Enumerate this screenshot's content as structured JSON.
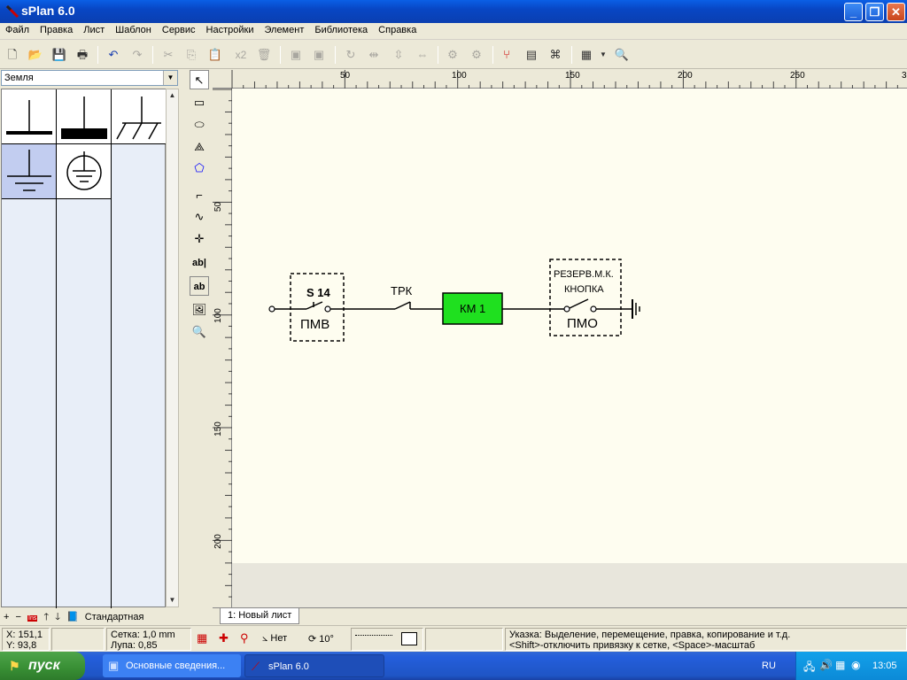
{
  "window": {
    "title": "sPlan 6.0"
  },
  "menu": [
    "Файл",
    "Правка",
    "Лист",
    "Шаблон",
    "Сервис",
    "Настройки",
    "Элемент",
    "Библиотека",
    "Справка"
  ],
  "toolbar": {
    "paste_x2": "x2"
  },
  "library": {
    "selected": "Земля",
    "footer_label": "Стандартная",
    "footer_icon": "Ins"
  },
  "tools": {
    "text_tool": "ab|",
    "text_frame_tool": "ab"
  },
  "rulers": {
    "h_labels": [
      "50",
      "100",
      "150",
      "200",
      "250",
      "3"
    ],
    "v_labels": [
      "50",
      "100",
      "150",
      "200"
    ]
  },
  "schematic": {
    "switch1": {
      "label_top": "S 14",
      "label_bottom": "ПМВ"
    },
    "switch2": {
      "label": "ТРК"
    },
    "coil": {
      "label": "КМ 1",
      "color": "#1fe01f"
    },
    "button": {
      "label_top1": "РЕЗЕРВ.М.К.",
      "label_top2": "КНОПКА",
      "label_bottom": "ПМО"
    }
  },
  "sheet_tab": "1: Новый лист",
  "status": {
    "x": "X: 151,1",
    "y": "Y: 93,8",
    "grid": "Сетка:  1,0 mm",
    "zoom": "Лупа:   0,85",
    "snap_label": "Нет",
    "angle": "10°",
    "hint1": "Указка: Выделение, перемещение, правка, копирование и т.д.",
    "hint2": "<Shift>-отключить привязку к сетке, <Space>-масштаб"
  },
  "taskbar": {
    "start": "пуск",
    "tasks": [
      "Основные сведения...",
      "sPlan 6.0"
    ],
    "lang": "RU",
    "clock": "13:05"
  }
}
